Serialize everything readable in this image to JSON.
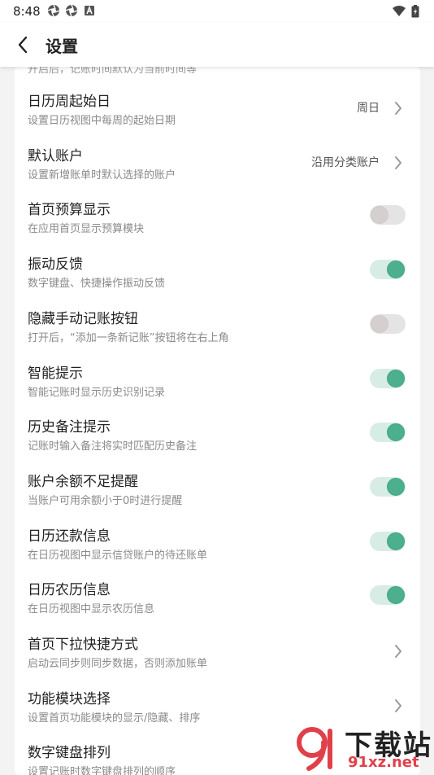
{
  "status_bar": {
    "time": "8:48"
  },
  "header": {
    "title": "设置"
  },
  "clipped_top_text": "开启后，记账时间默认为当前时间等",
  "rows": [
    {
      "title": "日历周起始日",
      "desc": "设置日历视图中每周的起始日期",
      "value": "周日",
      "control": "chevron"
    },
    {
      "title": "默认账户",
      "desc": "设置新增账单时默认选择的账户",
      "value": "沿用分类账户",
      "control": "chevron"
    },
    {
      "title": "首页预算显示",
      "desc": "在应用首页显示预算模块",
      "control": "toggle",
      "on": false
    },
    {
      "title": "振动反馈",
      "desc": "数字键盘、快捷操作振动反馈",
      "control": "toggle",
      "on": true
    },
    {
      "title": "隐藏手动记账按钮",
      "desc": "打开后，“添加一条新记账”按钮将在右上角",
      "control": "toggle",
      "on": false
    },
    {
      "title": "智能提示",
      "desc": "智能记账时显示历史识别记录",
      "control": "toggle",
      "on": true
    },
    {
      "title": "历史备注提示",
      "desc": "记账时输入备注将实时匹配历史备注",
      "control": "toggle",
      "on": true
    },
    {
      "title": "账户余额不足提醒",
      "desc": "当账户可用余额小于0时进行提醒",
      "control": "toggle",
      "on": true
    },
    {
      "title": "日历还款信息",
      "desc": "在日历视图中显示信贷账户的待还账单",
      "control": "toggle",
      "on": true
    },
    {
      "title": "日历农历信息",
      "desc": "在日历视图中显示农历信息",
      "control": "toggle",
      "on": true
    },
    {
      "title": "首页下拉快捷方式",
      "desc": "启动云同步则同步数据，否则添加账单",
      "control": "chevron"
    },
    {
      "title": "功能模块选择",
      "desc": "设置首页功能模块的显示/隐藏、排序",
      "control": "chevron"
    },
    {
      "title": "数字键盘排列",
      "desc": "设置记账时数字键盘排列的顺序",
      "control": "none"
    }
  ],
  "colors": {
    "accent": "#4caf8e",
    "toggle_off_knob": "#d5cfcf",
    "background": "#f3f3f3"
  },
  "watermark": {
    "text": "下载站",
    "url": "91xz.net"
  }
}
